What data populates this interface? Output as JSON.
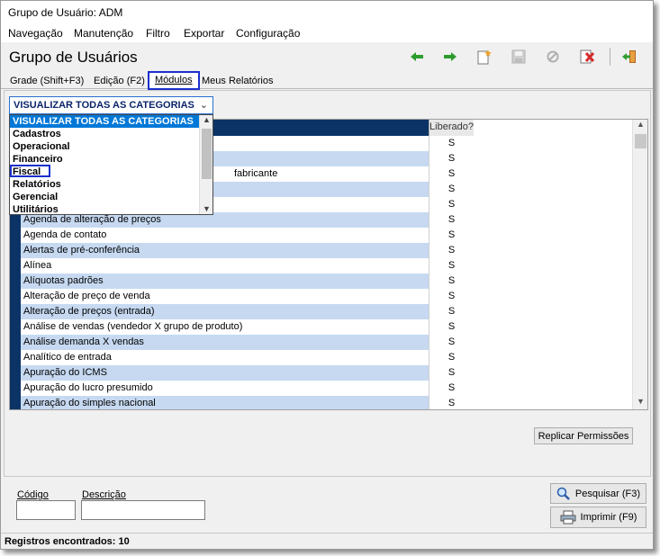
{
  "window": {
    "title": "Grupo de Usuário: ADM"
  },
  "menu": [
    {
      "label": "Navegação"
    },
    {
      "label": "Manutenção"
    },
    {
      "label": "Filtro"
    },
    {
      "label": "Exportar"
    },
    {
      "label": "Configuração"
    }
  ],
  "header": {
    "title": "Grupo de Usuários"
  },
  "toolbar": {
    "icons": [
      "arrow-left-icon",
      "arrow-right-icon",
      "new-document-icon",
      "save-icon",
      "cancel-icon",
      "delete-icon",
      "exit-icon"
    ],
    "colors": {
      "arrow": "#2e9b2e",
      "new": "#f0a020",
      "delete": "#d62b2b",
      "disabled": "#b0b0b0"
    }
  },
  "tabs": [
    {
      "label": "Grade (Shift+F3)"
    },
    {
      "label": "Edição (F2)"
    },
    {
      "label": "Módulos"
    },
    {
      "label": "Meus Relatórios"
    }
  ],
  "category_select": {
    "value": "VISUALIZAR TODAS AS CATEGORIAS",
    "options": [
      "VISUALIZAR TODAS AS CATEGORIAS",
      "Cadastros",
      "Operacional",
      "Financeiro",
      "Fiscal",
      "Relatórios",
      "Gerencial",
      "Utilitários"
    ]
  },
  "grid": {
    "column_liberado": "Liberado?",
    "rows": [
      {
        "name": "",
        "liberado": "S"
      },
      {
        "name": "",
        "liberado": "S"
      },
      {
        "name": "fabricante",
        "liberado": "S"
      },
      {
        "name": "",
        "liberado": "S"
      },
      {
        "name": "",
        "liberado": "S"
      },
      {
        "name": "Agenda de alteração de preços",
        "liberado": "S"
      },
      {
        "name": "Agenda de contato",
        "liberado": "S"
      },
      {
        "name": "Alertas de pré-conferência",
        "liberado": "S"
      },
      {
        "name": "Alínea",
        "liberado": "S"
      },
      {
        "name": "Alíquotas padrões",
        "liberado": "S"
      },
      {
        "name": "Alteração de preço de venda",
        "liberado": "S"
      },
      {
        "name": "Alteração de preços (entrada)",
        "liberado": "S"
      },
      {
        "name": "Análise de vendas (vendedor X grupo de produto)",
        "liberado": "S"
      },
      {
        "name": "Análise demanda X vendas",
        "liberado": "S"
      },
      {
        "name": "Analítico de entrada",
        "liberado": "S"
      },
      {
        "name": "Apuração do ICMS",
        "liberado": "S"
      },
      {
        "name": "Apuração do lucro presumido",
        "liberado": "S"
      },
      {
        "name": "Apuração do simples nacional",
        "liberado": "S"
      }
    ]
  },
  "buttons": {
    "replicar": "Replicar Permissões",
    "pesquisar": "Pesquisar (F3)",
    "imprimir": "Imprimir (F9)"
  },
  "filters": {
    "codigo_label": "Código",
    "descricao_label": "Descrição",
    "codigo_value": "",
    "descricao_value": ""
  },
  "status": {
    "text": "Registros encontrados: 10"
  }
}
